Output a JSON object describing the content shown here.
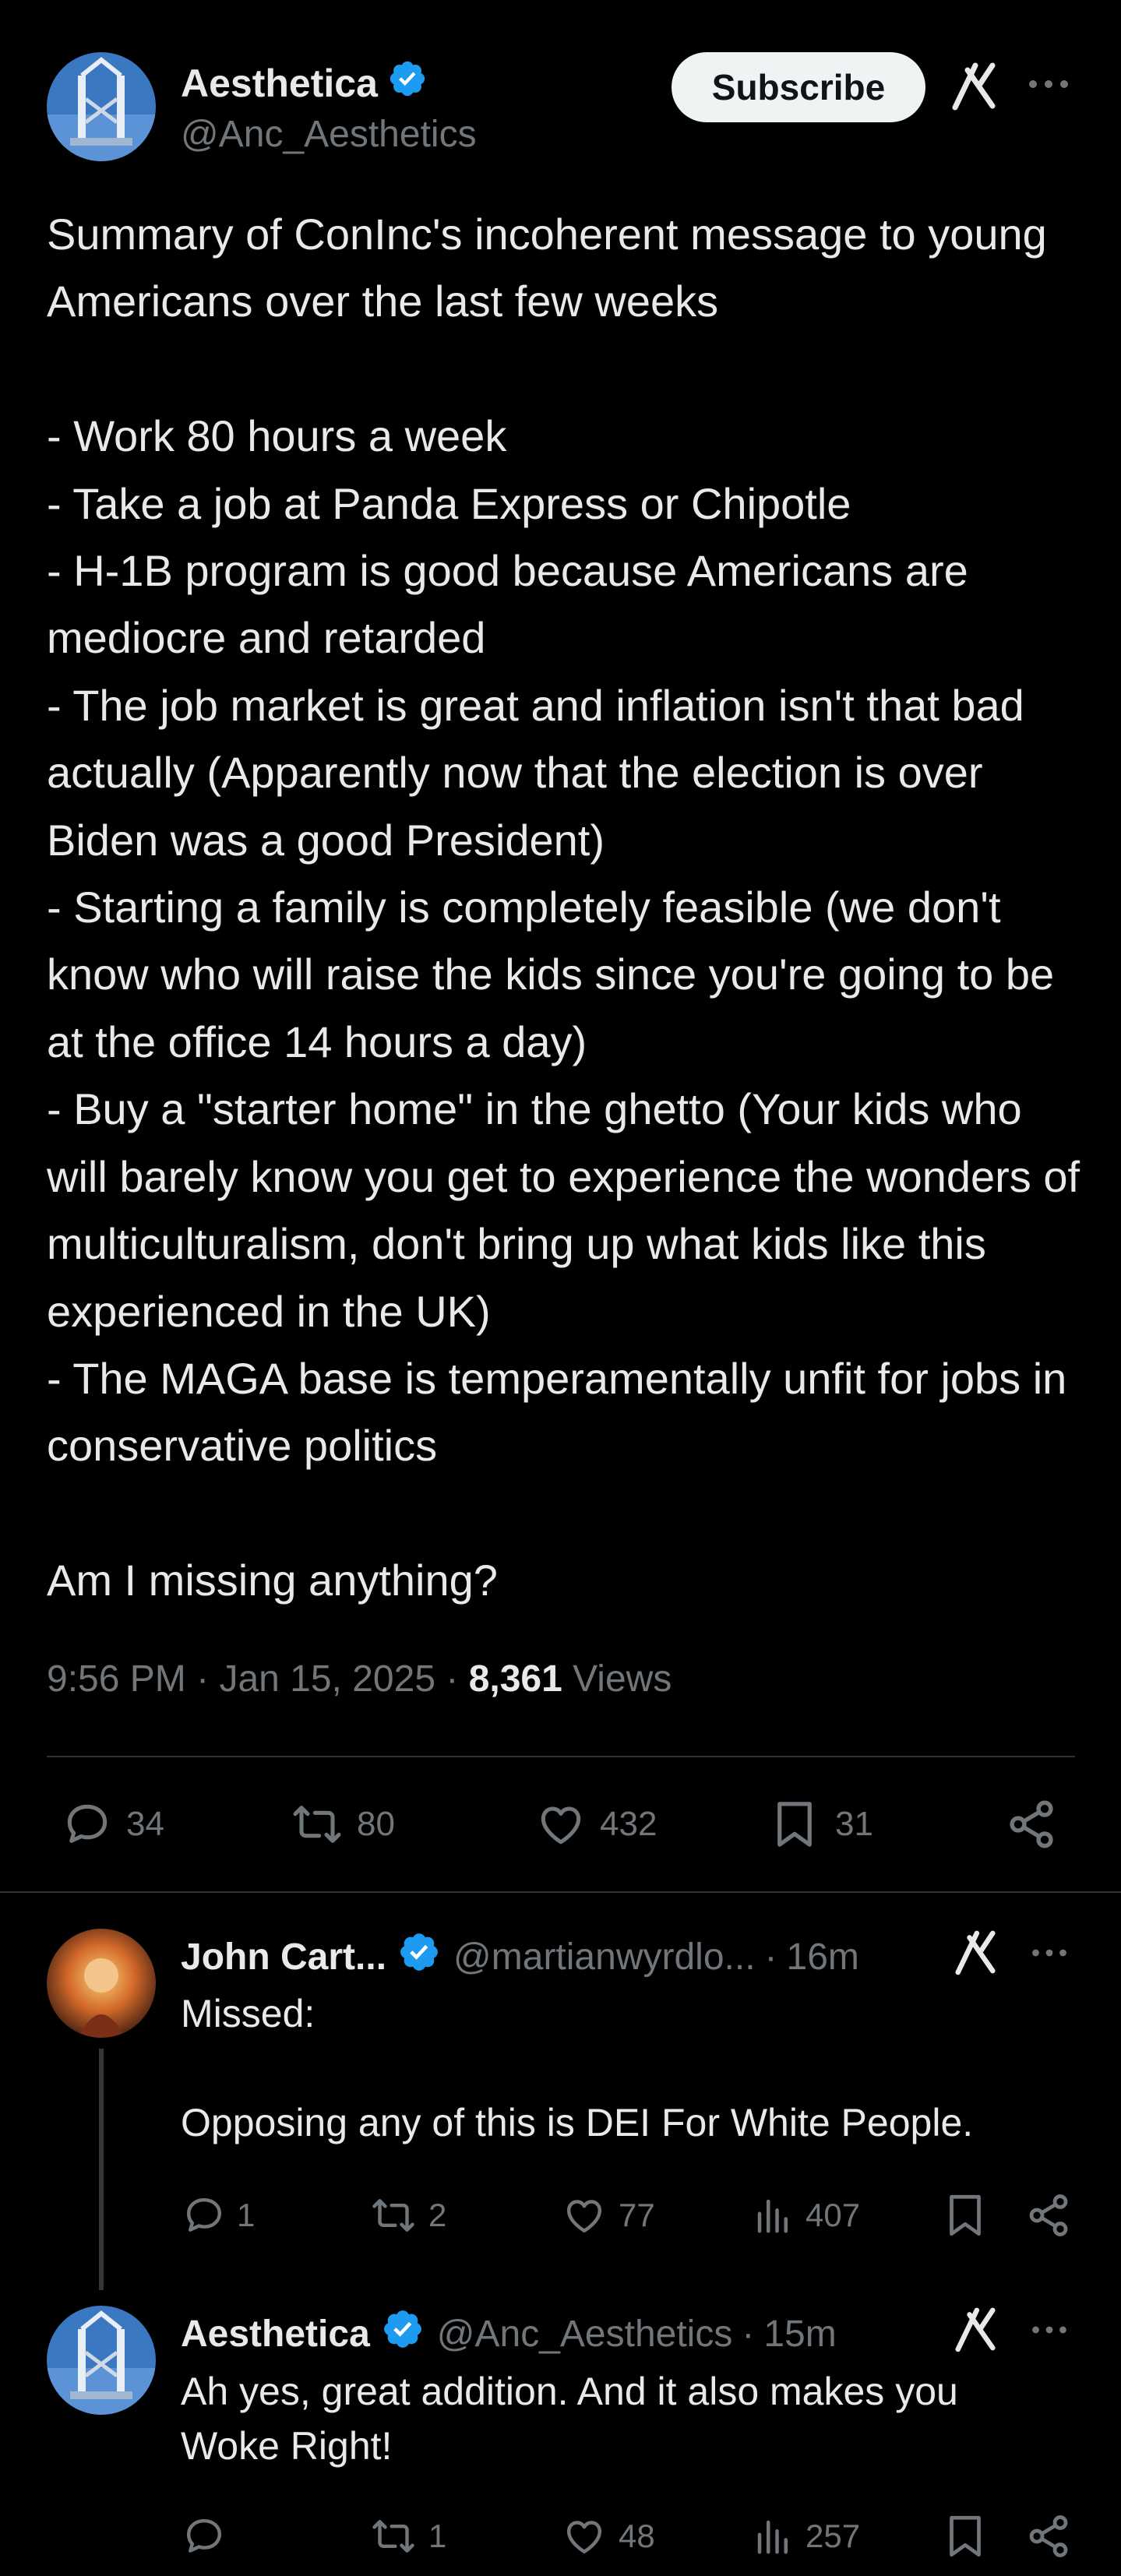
{
  "main_tweet": {
    "author_name": "Aesthetica",
    "author_handle": "@Anc_Aesthetics",
    "subscribe_label": "Subscribe",
    "text": "Summary of ConInc's incoherent message to young Americans over the last few weeks\n\n- Work 80 hours a week\n- Take a job at Panda Express or Chipotle\n- H-1B program is good because Americans are mediocre and retarded\n- The job market is great and inflation isn't that bad actually (Apparently now that the election is over Biden was a good President)\n- Starting a family is completely feasible (we don't know who will raise the kids since you're going to be at the office 14 hours a day)\n- Buy a \"starter home\" in the ghetto (Your kids who will barely know you get to experience the wonders of multiculturalism, don't bring up what kids like this experienced in the UK)\n- The MAGA base is temperamentally unfit for jobs in conservative politics\n\nAm I missing anything?",
    "time": "9:56 PM",
    "date": "Jan 15, 2025",
    "views_count": "8,361",
    "views_label": "Views",
    "replies": "34",
    "reposts": "80",
    "likes": "432",
    "bookmarks": "31"
  },
  "replies": [
    {
      "author_name": "John Cart...",
      "author_handle": "@martianwyrdlo...",
      "time": "16m",
      "text": "Missed:\n\nOpposing any of this is DEI For White People.",
      "replies": "1",
      "reposts": "2",
      "likes": "77",
      "views": "407"
    },
    {
      "author_name": "Aesthetica",
      "author_handle": "@Anc_Aesthetics",
      "time": "15m",
      "text": "Ah yes, great addition. And it also makes you Woke Right!",
      "replies": "",
      "reposts": "1",
      "likes": "48",
      "views": "257"
    }
  ],
  "separator": "·",
  "colors": {
    "background": "#000000",
    "text": "#e7e9ea",
    "muted": "#71767b",
    "verified": "#1d9bf0",
    "divider": "#2f3336"
  }
}
